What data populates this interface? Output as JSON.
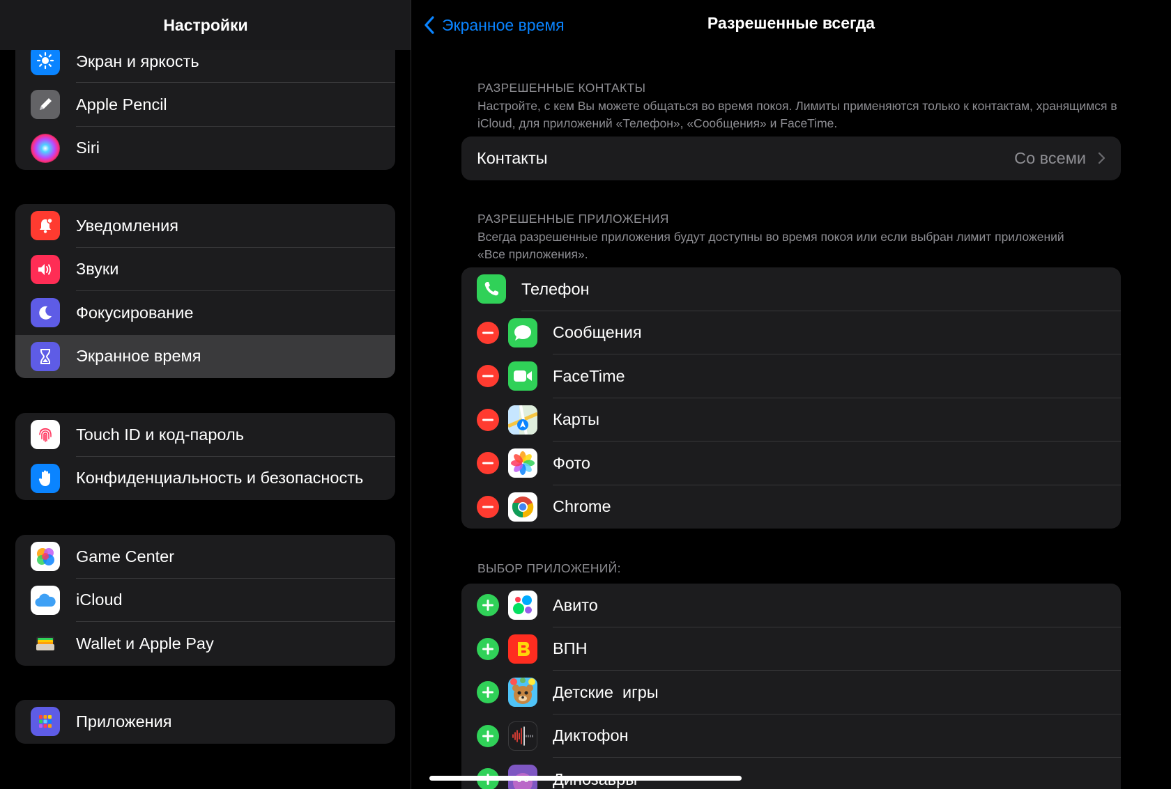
{
  "sidebar": {
    "title": "Настройки",
    "groups": [
      {
        "items": [
          {
            "label": "Экран и яркость",
            "icon": "sun-icon"
          },
          {
            "label": "Apple Pencil",
            "icon": "pencil-icon"
          },
          {
            "label": "Siri",
            "icon": "siri-icon"
          }
        ]
      },
      {
        "items": [
          {
            "label": "Уведомления",
            "icon": "bell-icon"
          },
          {
            "label": "Звуки",
            "icon": "speaker-icon"
          },
          {
            "label": "Фокусирование",
            "icon": "moon-icon"
          },
          {
            "label": "Экранное время",
            "icon": "hourglass-icon",
            "selected": true
          }
        ]
      },
      {
        "items": [
          {
            "label": "Touch ID и код-пароль",
            "icon": "fingerprint-icon"
          },
          {
            "label": "Конфиденциальность и безопасность",
            "icon": "hand-icon"
          }
        ]
      },
      {
        "items": [
          {
            "label": "Game Center",
            "icon": "game-center-icon"
          },
          {
            "label": "iCloud",
            "icon": "cloud-icon"
          },
          {
            "label": "Wallet и Apple Pay",
            "icon": "wallet-icon"
          }
        ]
      },
      {
        "items": [
          {
            "label": "Приложения",
            "icon": "apps-grid-icon"
          }
        ]
      }
    ]
  },
  "nav": {
    "back_label": "Экранное время",
    "title": "Разрешенные всегда"
  },
  "contacts_section": {
    "caption": "РАЗРЕШЕННЫЕ КОНТАКТЫ",
    "description": "Настройте, с кем Вы можете общаться во время покоя. Лимиты применяются только к контактам, хранящимся в iCloud, для приложений «Телефон», «Сообщения» и FaceTime.",
    "row_label": "Контакты",
    "row_value": "Со всеми"
  },
  "allowed_section": {
    "caption": "РАЗРЕШЕННЫЕ ПРИЛОЖЕНИЯ",
    "description": "Всегда разрешенные приложения будут доступны во время покоя или если выбран лимит приложений «Все приложения».",
    "apps": [
      {
        "label": "Телефон",
        "icon": "phone-app-icon",
        "removable": false
      },
      {
        "label": "Сообщения",
        "icon": "messages-app-icon",
        "removable": true
      },
      {
        "label": "FaceTime",
        "icon": "facetime-app-icon",
        "removable": true
      },
      {
        "label": "Карты",
        "icon": "maps-app-icon",
        "removable": true
      },
      {
        "label": "Фото",
        "icon": "photos-app-icon",
        "removable": true
      },
      {
        "label": "Chrome",
        "icon": "chrome-app-icon",
        "removable": true
      }
    ]
  },
  "choose_section": {
    "caption": "ВЫБОР ПРИЛОЖЕНИЙ:",
    "apps": [
      {
        "label": "Авито",
        "icon": "avito-app-icon"
      },
      {
        "label": "ВПН",
        "icon": "vpn-app-icon"
      },
      {
        "label": "Детские  игры",
        "icon": "kids-games-app-icon"
      },
      {
        "label": "Диктофон",
        "icon": "voice-memos-app-icon"
      },
      {
        "label": "Динозавры",
        "icon": "dinosaurs-app-icon"
      }
    ]
  },
  "colors": {
    "accent": "#0a84ff",
    "remove": "#ff3b30",
    "add": "#30d158",
    "row_bg": "#1c1c1e",
    "secondary_text": "#8e8e93"
  }
}
